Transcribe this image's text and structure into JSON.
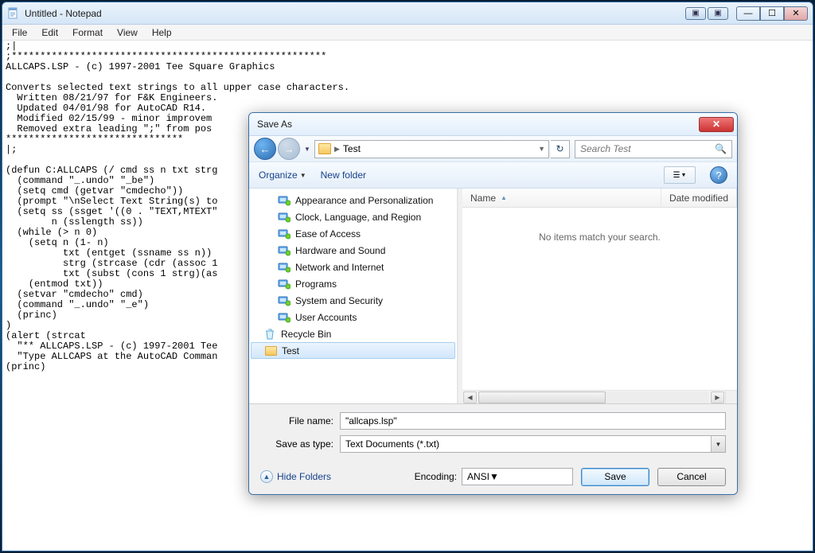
{
  "notepad": {
    "title": "Untitled - Notepad",
    "menu": {
      "file": "File",
      "edit": "Edit",
      "format": "Format",
      "view": "View",
      "help": "Help"
    },
    "content": ";|\n;*******************************************************\nALLCAPS.LSP - (c) 1997-2001 Tee Square Graphics\n\nConverts selected text strings to all upper case characters.\n  Written 08/21/97 for F&K Engineers.\n  Updated 04/01/98 for AutoCAD R14.\n  Modified 02/15/99 - minor improvem\n  Removed extra leading \";\" from pos\n*******************************\n|;\n\n(defun C:ALLCAPS (/ cmd ss n txt strg\n  (command \"_.undo\" \"_be\")\n  (setq cmd (getvar \"cmdecho\"))\n  (prompt \"\\nSelect Text String(s) to\n  (setq ss (ssget '((0 . \"TEXT,MTEXT\"\n        n (sslength ss))\n  (while (> n 0)\n    (setq n (1- n)\n          txt (entget (ssname ss n))\n          strg (strcase (cdr (assoc 1\n          txt (subst (cons 1 strg)(as\n    (entmod txt))\n  (setvar \"cmdecho\" cmd)\n  (command \"_.undo\" \"_e\")\n  (princ)\n)\n(alert (strcat\n  \"** ALLCAPS.LSP - (c) 1997-2001 Tee\n  \"Type ALLCAPS at the AutoCAD Comman\n(princ)"
  },
  "dialog": {
    "title": "Save As",
    "breadcrumb": {
      "folder": "Test"
    },
    "search": {
      "placeholder": "Search Test"
    },
    "toolbar": {
      "organize": "Organize",
      "newfolder": "New folder"
    },
    "tree": {
      "items": [
        {
          "label": "Appearance and Personalization",
          "kind": "cp"
        },
        {
          "label": "Clock, Language, and Region",
          "kind": "cp"
        },
        {
          "label": "Ease of Access",
          "kind": "cp"
        },
        {
          "label": "Hardware and Sound",
          "kind": "cp"
        },
        {
          "label": "Network and Internet",
          "kind": "cp"
        },
        {
          "label": "Programs",
          "kind": "cp"
        },
        {
          "label": "System and Security",
          "kind": "cp"
        },
        {
          "label": "User Accounts",
          "kind": "cp"
        }
      ],
      "recycle": "Recycle Bin",
      "test": "Test"
    },
    "columns": {
      "name": "Name",
      "date": "Date modified"
    },
    "empty": "No items match your search.",
    "filename_label": "File name:",
    "filename": "\"allcaps.lsp\"",
    "saveastype_label": "Save as type:",
    "saveastype": "Text Documents (*.txt)",
    "hidefolders": "Hide Folders",
    "encoding_label": "Encoding:",
    "encoding": "ANSI",
    "save": "Save",
    "cancel": "Cancel"
  }
}
